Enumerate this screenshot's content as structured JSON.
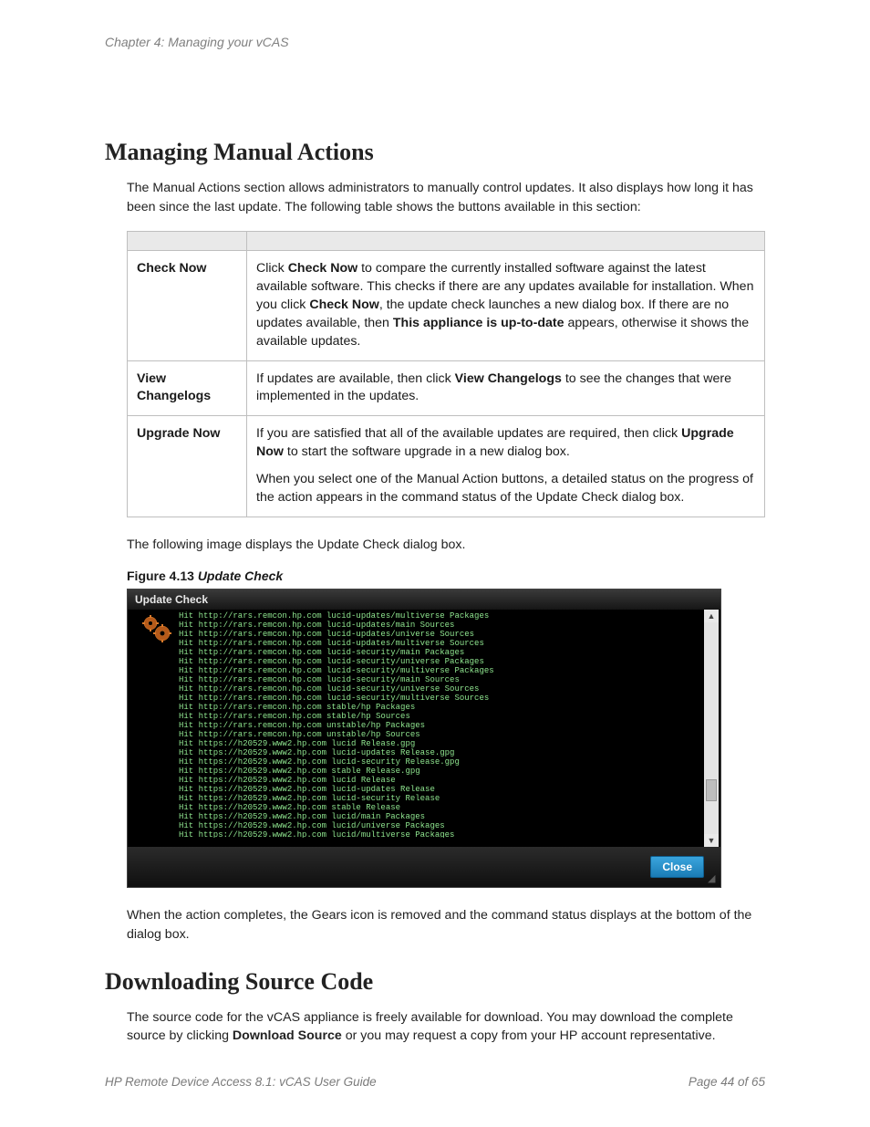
{
  "chapter": "Chapter 4: Managing your vCAS",
  "section1": {
    "title": "Managing Manual Actions",
    "intro": "The Manual Actions section allows administrators to manually control updates. It also displays how long it has been since the last update. The following table shows the buttons available in this section:",
    "table": {
      "rows": [
        {
          "label": "Check Now",
          "parts": [
            "Click ",
            "Check Now",
            " to compare the currently installed software against the latest available software. This checks if there are any updates available for installation. When you click ",
            "Check Now",
            ", the update check launches a new dialog box. If there are no updates available, then ",
            "This appliance is up-to-date",
            " appears, otherwise it shows the available updates."
          ]
        },
        {
          "label": "View Changelogs",
          "parts": [
            "If updates are available, then click ",
            "View Changelogs",
            " to see the changes that were implemented in the updates."
          ]
        },
        {
          "label": "Upgrade Now",
          "parts": [
            "If you are satisfied that all of the available updates are required, then click ",
            "Upgrade Now",
            " to start the software upgrade in a new dialog box."
          ],
          "extra": "When you select one of the Manual Action buttons, a detailed status on the progress of the action appears in the command status of the Update Check dialog box."
        }
      ]
    },
    "afterTable": "The following image displays the Update Check dialog box.",
    "figure": {
      "label": "Figure 4.13",
      "title": "Update Check"
    },
    "dialog": {
      "title": "Update Check",
      "close": "Close",
      "lines": [
        "Hit http://rars.remcon.hp.com lucid-updates/multiverse Packages",
        "Hit http://rars.remcon.hp.com lucid-updates/main Sources",
        "Hit http://rars.remcon.hp.com lucid-updates/universe Sources",
        "Hit http://rars.remcon.hp.com lucid-updates/multiverse Sources",
        "Hit http://rars.remcon.hp.com lucid-security/main Packages",
        "Hit http://rars.remcon.hp.com lucid-security/universe Packages",
        "Hit http://rars.remcon.hp.com lucid-security/multiverse Packages",
        "Hit http://rars.remcon.hp.com lucid-security/main Sources",
        "Hit http://rars.remcon.hp.com lucid-security/universe Sources",
        "Hit http://rars.remcon.hp.com lucid-security/multiverse Sources",
        "Hit http://rars.remcon.hp.com stable/hp Packages",
        "Hit http://rars.remcon.hp.com stable/hp Sources",
        "Hit http://rars.remcon.hp.com unstable/hp Packages",
        "Hit http://rars.remcon.hp.com unstable/hp Sources",
        "Hit https://h20529.www2.hp.com lucid Release.gpg",
        "Hit https://h20529.www2.hp.com lucid-updates Release.gpg",
        "Hit https://h20529.www2.hp.com lucid-security Release.gpg",
        "Hit https://h20529.www2.hp.com stable Release.gpg",
        "Hit https://h20529.www2.hp.com lucid Release",
        "Hit https://h20529.www2.hp.com lucid-updates Release",
        "Hit https://h20529.www2.hp.com lucid-security Release",
        "Hit https://h20529.www2.hp.com stable Release",
        "Hit https://h20529.www2.hp.com lucid/main Packages",
        "Hit https://h20529.www2.hp.com lucid/universe Packages",
        "Hit https://h20529.www2.hp.com lucid/multiverse Packages"
      ]
    },
    "afterDialog": "When the action completes, the Gears icon is removed and the command status displays at the bottom of the dialog box."
  },
  "section2": {
    "title": "Downloading Source Code",
    "para_parts": [
      "The source code for the vCAS appliance is freely available for download. You may download the complete source by clicking ",
      "Download Source",
      " or you may request a copy from your HP account representative."
    ]
  },
  "footer": {
    "left": "HP Remote Device Access 8.1: vCAS User Guide",
    "right": "Page 44 of 65"
  }
}
